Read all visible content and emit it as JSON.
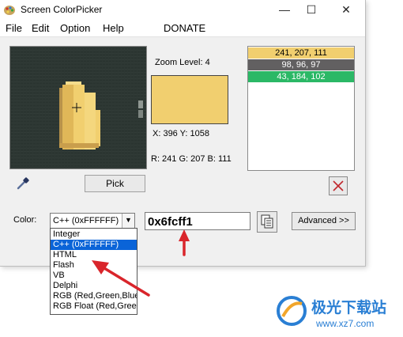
{
  "window": {
    "title": "Screen ColorPicker",
    "controls": {
      "minimize": "—",
      "maximize": "☐",
      "close": "✕"
    }
  },
  "menu": [
    "File",
    "Edit",
    "Option",
    "Help",
    "DONATE"
  ],
  "zoom": {
    "label": "Zoom Level: 4"
  },
  "coords": "X: 396 Y: 1058",
  "rgb": "R: 241 G: 207 B: 111",
  "preview_color": "#f1cf6f",
  "history": [
    {
      "text": "241, 207, 111",
      "bg": "#f1cf6f",
      "fg": "#000000"
    },
    {
      "text": "98, 96, 97",
      "bg": "#626061",
      "fg": "#ffffff"
    },
    {
      "text": "43, 184, 102",
      "bg": "#2bb866",
      "fg": "#ffffff"
    }
  ],
  "buttons": {
    "pick": "Pick",
    "advanced": "Advanced >>"
  },
  "color_label": "Color:",
  "format": {
    "selected": "C++ (0xFFFFFF)",
    "options": [
      "Integer",
      "C++ (0xFFFFFF)",
      "HTML",
      "Flash",
      "VB",
      "Delphi",
      "RGB (Red,Green,Blue",
      "RGB Float (Red,Greer"
    ],
    "selected_index": 1
  },
  "code_value": "0x6fcff1",
  "watermark": {
    "text": "极光下载站",
    "url": "www.xz7.com"
  },
  "colors": {
    "accent": "#0a64d8",
    "arrow": "#d9252b"
  }
}
